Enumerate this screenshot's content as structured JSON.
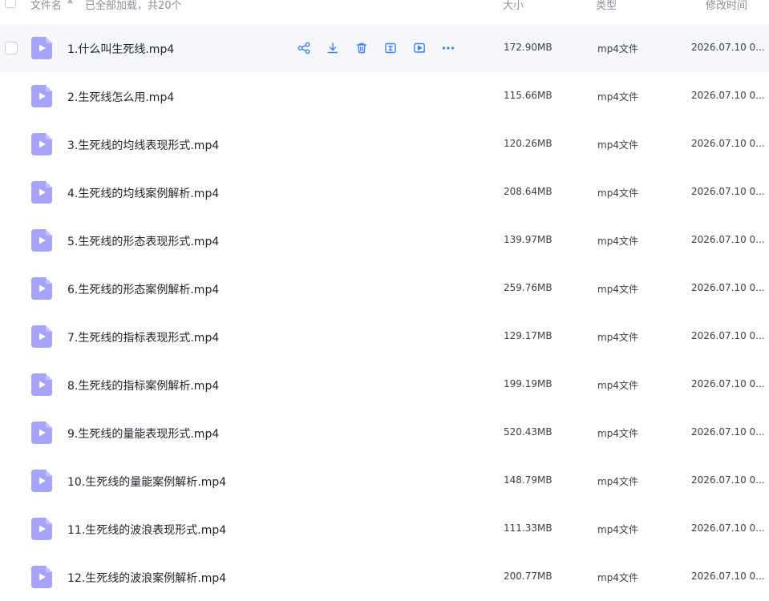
{
  "header": {
    "name_label": "文件名",
    "loaded_label": "已全部加载，共20个",
    "size_label": "大小",
    "type_label": "类型",
    "modified_label": "修改时间"
  },
  "colors": {
    "accent": "#3b82f6",
    "file_icon": "#a7a3fb",
    "hover_bg": "#f5f7fa"
  },
  "actions": [
    "share-icon",
    "download-icon",
    "delete-icon",
    "rename-icon",
    "play-icon",
    "more-icon"
  ],
  "files": [
    {
      "name": "1.什么叫生死线.mp4",
      "size": "172.90MB",
      "type": "mp4文件",
      "modified": "2026.07.10 0..."
    },
    {
      "name": "2.生死线怎么用.mp4",
      "size": "115.66MB",
      "type": "mp4文件",
      "modified": "2026.07.10 0..."
    },
    {
      "name": "3.生死线的均线表现形式.mp4",
      "size": "120.26MB",
      "type": "mp4文件",
      "modified": "2026.07.10 0..."
    },
    {
      "name": "4.生死线的均线案例解析.mp4",
      "size": "208.64MB",
      "type": "mp4文件",
      "modified": "2026.07.10 0..."
    },
    {
      "name": "5.生死线的形态表现形式.mp4",
      "size": "139.97MB",
      "type": "mp4文件",
      "modified": "2026.07.10 0..."
    },
    {
      "name": "6.生死线的形态案例解析.mp4",
      "size": "259.76MB",
      "type": "mp4文件",
      "modified": "2026.07.10 0..."
    },
    {
      "name": "7.生死线的指标表现形式.mp4",
      "size": "129.17MB",
      "type": "mp4文件",
      "modified": "2026.07.10 0..."
    },
    {
      "name": "8.生死线的指标案例解析.mp4",
      "size": "199.19MB",
      "type": "mp4文件",
      "modified": "2026.07.10 0..."
    },
    {
      "name": "9.生死线的量能表现形式.mp4",
      "size": "520.43MB",
      "type": "mp4文件",
      "modified": "2026.07.10 0..."
    },
    {
      "name": "10.生死线的量能案例解析.mp4",
      "size": "148.79MB",
      "type": "mp4文件",
      "modified": "2026.07.10 0..."
    },
    {
      "name": "11.生死线的波浪表现形式.mp4",
      "size": "111.33MB",
      "type": "mp4文件",
      "modified": "2026.07.10 0..."
    },
    {
      "name": "12.生死线的波浪案例解析.mp4",
      "size": "200.77MB",
      "type": "mp4文件",
      "modified": "2026.07.10 0..."
    }
  ]
}
